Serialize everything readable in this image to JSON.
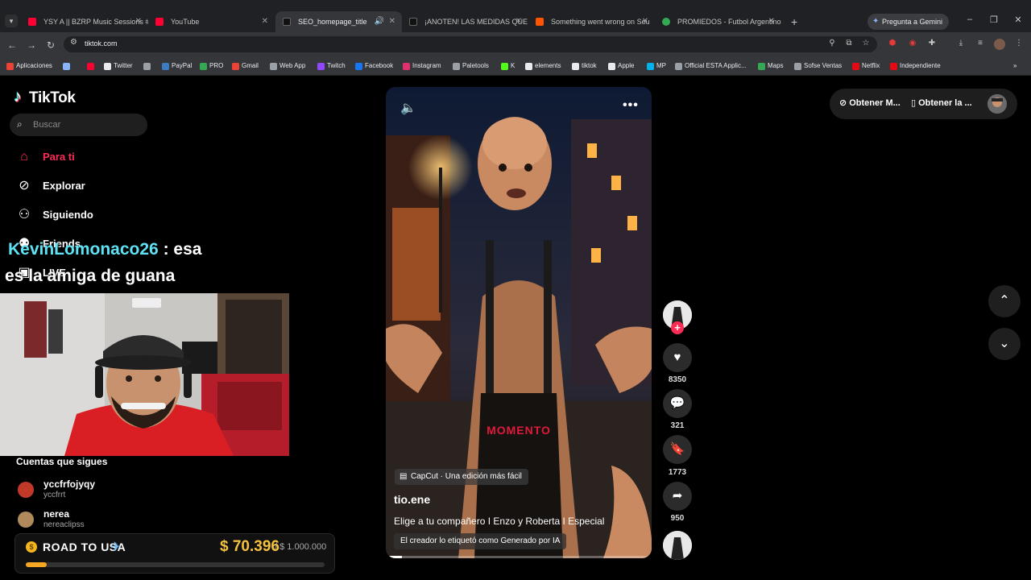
{
  "browser": {
    "tabs": [
      {
        "title": "YSY A || BZRP Music Sessions #",
        "favicon_color": "#ff0033"
      },
      {
        "title": "YouTube",
        "favicon_color": "#ff0033"
      },
      {
        "title": "SEO_homepage_title",
        "favicon_color": "#111111"
      },
      {
        "title": "¡ANOTEN! LAS MEDIDAS QUE T",
        "favicon_color": "#111111"
      },
      {
        "title": "Something went wrong on Sou",
        "favicon_color": "#ff5500"
      },
      {
        "title": "PROMIEDOS - Futbol Argentino",
        "favicon_color": "#34a853"
      }
    ],
    "gemini_label": "Pregunta a Gemini",
    "url": "tiktok.com",
    "bookmarks": [
      {
        "label": "Aplicaciones",
        "color": "#ea4335"
      },
      {
        "label": "",
        "color": "#8ab4f8"
      },
      {
        "label": "",
        "color": "#ff0033"
      },
      {
        "label": "Twitter",
        "color": "#e8eaed"
      },
      {
        "label": "",
        "color": "#9aa0a6"
      },
      {
        "label": "PayPal",
        "color": "#3b7bbf"
      },
      {
        "label": "PRO",
        "color": "#34a853"
      },
      {
        "label": "Gmail",
        "color": "#ea4335"
      },
      {
        "label": "Web App",
        "color": "#9aa0a6"
      },
      {
        "label": "Twitch",
        "color": "#9146ff"
      },
      {
        "label": "Facebook",
        "color": "#1877f2"
      },
      {
        "label": "Instagram",
        "color": "#e1306c"
      },
      {
        "label": "Paletools",
        "color": "#9aa0a6"
      },
      {
        "label": "K",
        "color": "#53fc18"
      },
      {
        "label": "elements",
        "color": "#e8eaed"
      },
      {
        "label": "tiktok",
        "color": "#e8eaed"
      },
      {
        "label": "Apple",
        "color": "#e8eaed"
      },
      {
        "label": "MP",
        "color": "#00b1ea"
      },
      {
        "label": "Official ESTA Applic...",
        "color": "#9aa0a6"
      },
      {
        "label": "Maps",
        "color": "#34a853"
      },
      {
        "label": "Sofse Ventas",
        "color": "#9aa0a6"
      },
      {
        "label": "Netflix",
        "color": "#e50914"
      },
      {
        "label": "Independiente",
        "color": "#e50914"
      }
    ]
  },
  "tiktok": {
    "logo_text": "TikTok",
    "search_placeholder": "Buscar",
    "nav": [
      {
        "label": "Para ti",
        "icon": "home-icon"
      },
      {
        "label": "Explorar",
        "icon": "compass-icon"
      },
      {
        "label": "Siguiendo",
        "icon": "following-icon"
      },
      {
        "label": "Friends",
        "icon": "friends-icon"
      },
      {
        "label": "LIVE",
        "icon": "live-icon"
      }
    ],
    "following_title": "Cuentas que sigues",
    "following": [
      {
        "name": "yccfrfojyqy",
        "handle": "yccfrrt",
        "avatar_color": "#c0392b"
      },
      {
        "name": "nerea",
        "handle": "nereaclipss",
        "avatar_color": "#b08a5a"
      }
    ],
    "video": {
      "overlay_text": "MOMENTO",
      "capcut_label": "CapCut · Una edición más fácil",
      "author": "tio.ene",
      "description": "Elige a tu compañero I Enzo y Roberta I Especial",
      "ai_label": "El creador lo etiquetó como Generado por IA",
      "progress": 0.06
    },
    "actions": {
      "likes": "8350",
      "comments": "321",
      "saves": "1773",
      "shares": "950"
    },
    "top_buttons": [
      "Obtener M...",
      "Obtener la ..."
    ]
  },
  "stream_overlay": {
    "chat_user": "KevinLomonaco26",
    "chat_message_part1": ": esa",
    "chat_message_part2": "es la amiga de guana",
    "goal_title": "ROAD TO USA",
    "goal_amount": "$ 70.396",
    "goal_target": "/ $ 1.000.000",
    "goal_progress": 0.07
  }
}
